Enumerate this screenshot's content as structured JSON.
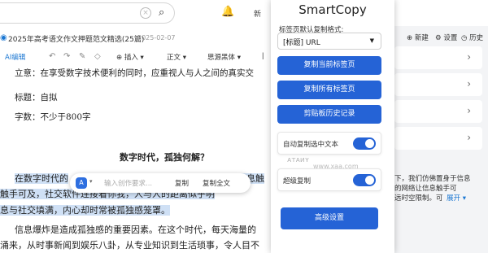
{
  "topbar": {
    "search_clear": "×",
    "search_icon": "⌕",
    "bell_icon": "🔔",
    "new_label": "新"
  },
  "doc": {
    "doc_icon": "◉",
    "title": "2025年高考语文作文押题范文精选(25篇)",
    "date": "2025-02-07",
    "toolbar": {
      "ai_label": "AI编辑",
      "insert_label": "⊕ 插入 ▾",
      "style_label": "正文 ▾",
      "font_label": "思源黑体 ▾",
      "more": "ǀ"
    },
    "lines": {
      "topic": "立意：在享受数字技术便利的同时，应重视人与人之间的真实交",
      "title_req": "标题：自拟",
      "word_req": "字数：不少于800字"
    },
    "essay_title": "数字时代，孤独何解？",
    "para1": {
      "l1": "在数字时代的",
      "l1_tail": "信息触",
      "l2": "触手可及，社交软件连接着你我，人与人的距离似乎明",
      "l3": "息与社交填满，内心却时常被孤独感笼罩。"
    },
    "para2": {
      "l1": "信息爆炸是造成孤独感的重要因素。在这个时代，每天海量的",
      "l2": "涌来，从时事新闻到娱乐八卦，从专业知识到生活琐事，令人目不"
    }
  },
  "ai_bar": {
    "logo": "A",
    "caret": "▾",
    "placeholder": "输入创作要求...",
    "copy_label": "复制",
    "copy_all_label": "复制全文"
  },
  "right_panel": {
    "new_label": "⊕ 新建",
    "settings_label": "⚙ 设置",
    "history_label": "◷ 历史",
    "chevron": "›",
    "text1": "下，我们仿佛置身于信息",
    "text2": "的网络让信息触手可",
    "text3": "远时空限制。可",
    "expand": "展开 ▾"
  },
  "popup": {
    "title": "SmartCopy",
    "format_label": "标签页默认复制格式:",
    "format_value": "[标题] URL",
    "select_arrow": "▼",
    "btn_copy_current": "复制当前标签页",
    "btn_copy_all": "复制所有标签页",
    "btn_clipboard": "剪贴板历史记录",
    "auto_copy_label": "自动复制选中文本",
    "super_copy_label": "超级复制",
    "advanced_label": "高级设置",
    "watermark": "ᴀᴛᴀᴎʏ",
    "watermark2": "www.xaa.com"
  },
  "toggles": {
    "auto_copy_on": true,
    "super_copy_on": true
  },
  "colors": {
    "accent": "#2563d6",
    "highlight": "#cfe0f5"
  }
}
